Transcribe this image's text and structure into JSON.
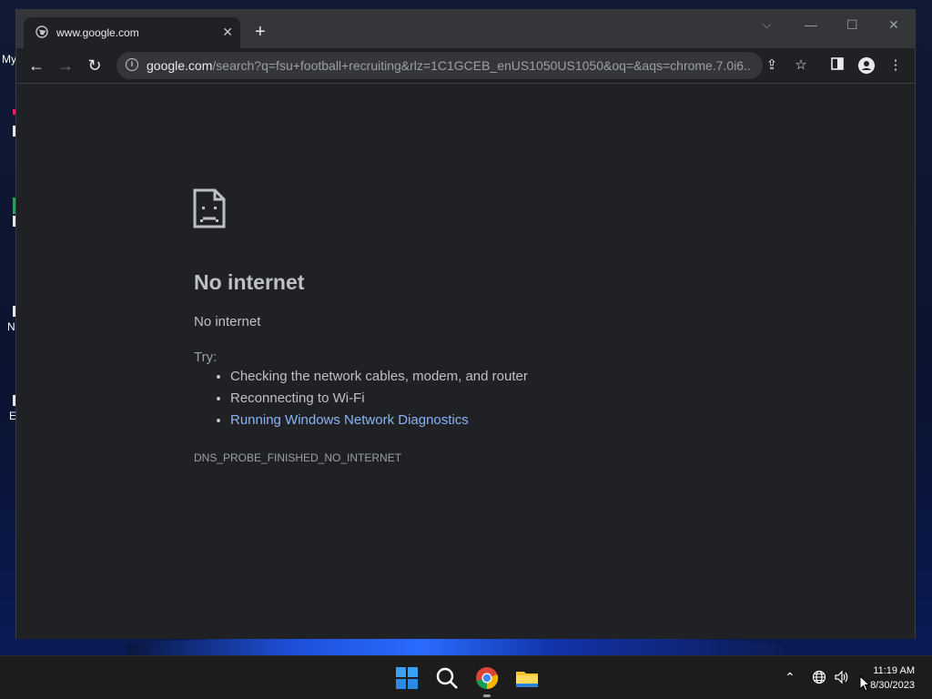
{
  "desktop": {
    "icon_labels": [
      "My",
      "N",
      "E"
    ]
  },
  "browser": {
    "tab": {
      "title": "www.google.com"
    },
    "window_controls": {
      "minimize": "—",
      "maximize": "☐",
      "close": "✕"
    },
    "omnibox": {
      "host": "google.com",
      "path": "/search?q=fsu+football+recruiting&rlz=1C1GCEB_enUS1050US1050&oq=&aqs=chrome.7.0i6..."
    }
  },
  "error_page": {
    "heading": "No internet",
    "subheading": "No internet",
    "try_label": "Try:",
    "suggestions": [
      "Checking the network cables, modem, and router",
      "Reconnecting to Wi-Fi",
      "Running Windows Network Diagnostics"
    ],
    "error_code": "DNS_PROBE_FINISHED_NO_INTERNET"
  },
  "taskbar": {
    "apps": [
      "start-icon",
      "search-icon",
      "chrome-icon",
      "file-explorer-icon"
    ],
    "tray_icons": [
      "chevron-up-icon",
      "globe-network-icon",
      "speaker-icon"
    ],
    "time": "11:19 AM",
    "date": "8/30/2023"
  },
  "colors": {
    "link": "#8ab4f8",
    "page_bg": "#202124",
    "tabstrip_bg": "#35363a"
  }
}
